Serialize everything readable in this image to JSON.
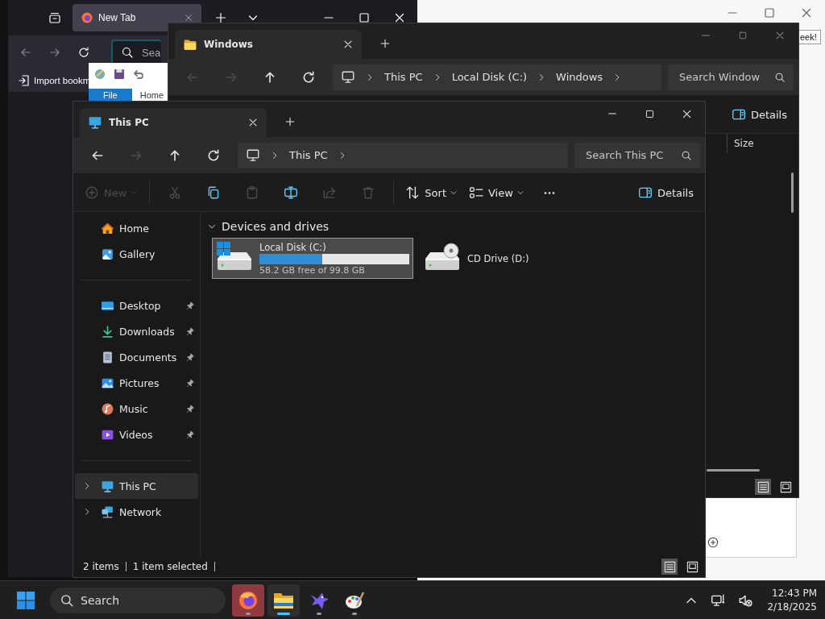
{
  "browser_window": {
    "tab": {
      "title": "New Tab"
    },
    "search": {
      "placeholder": "Sea"
    },
    "bookmarks": [
      {
        "label": "Import bookm"
      }
    ]
  },
  "ribbon_window": {
    "tabs": [
      {
        "label": "File",
        "selected": true
      },
      {
        "label": "Home",
        "selected": false
      }
    ]
  },
  "background_window": {
    "button": "eek!"
  },
  "folder_window": {
    "tab": "Windows",
    "nav": [
      {
        "kind": "back",
        "disabled": true
      },
      {
        "kind": "forward",
        "disabled": true
      },
      {
        "kind": "up",
        "disabled": false
      },
      {
        "kind": "refresh",
        "disabled": false
      }
    ],
    "breadcrumb": [
      "This PC",
      "Local Disk (C:)",
      "Windows"
    ],
    "search": {
      "placeholder": "Search Window"
    },
    "details_button": "Details",
    "columns": [
      "Size"
    ],
    "view_modes": [
      {
        "kind": "details",
        "selected": true
      },
      {
        "kind": "tiles",
        "selected": false
      }
    ]
  },
  "explorer": {
    "tab": "This PC",
    "nav": [
      {
        "kind": "back",
        "disabled": false
      },
      {
        "kind": "forward",
        "disabled": true
      },
      {
        "kind": "up",
        "disabled": false
      },
      {
        "kind": "refresh",
        "disabled": false
      }
    ],
    "breadcrumb": [
      "This PC"
    ],
    "search": {
      "placeholder": "Search This PC"
    },
    "toolbar": [
      {
        "kind": "new",
        "label": "New",
        "disabled": true
      },
      {
        "kind": "cut",
        "disabled": true
      },
      {
        "kind": "copy",
        "disabled": false
      },
      {
        "kind": "paste",
        "disabled": true
      },
      {
        "kind": "rename",
        "disabled": false
      },
      {
        "kind": "share",
        "disabled": true
      },
      {
        "kind": "delete",
        "disabled": true
      },
      {
        "kind": "sort",
        "label": "Sort",
        "disabled": false
      },
      {
        "kind": "view",
        "label": "View",
        "disabled": false
      },
      {
        "kind": "more",
        "disabled": false
      }
    ],
    "details_button": "Details",
    "sidebar": {
      "quick": [
        {
          "kind": "home",
          "label": "Home",
          "selected": false
        },
        {
          "kind": "gallery",
          "label": "Gallery",
          "selected": false
        }
      ],
      "pinned": [
        {
          "kind": "desktop",
          "label": "Desktop",
          "pinned": true,
          "selected": false
        },
        {
          "kind": "downloads",
          "label": "Downloads",
          "pinned": true,
          "selected": false
        },
        {
          "kind": "documents",
          "label": "Documents",
          "pinned": true,
          "selected": false
        },
        {
          "kind": "pictures",
          "label": "Pictures",
          "pinned": true,
          "selected": false
        },
        {
          "kind": "music",
          "label": "Music",
          "pinned": true,
          "selected": false
        },
        {
          "kind": "videos",
          "label": "Videos",
          "pinned": true,
          "selected": false
        }
      ],
      "tree": [
        {
          "kind": "pc",
          "label": "This PC",
          "expanded": false,
          "selected": true
        },
        {
          "kind": "network",
          "label": "Network",
          "expanded": false,
          "selected": false
        }
      ]
    },
    "section": {
      "title": "Devices and drives",
      "expanded": true
    },
    "drives": [
      {
        "kind": "system",
        "name": "Local Disk (C:)",
        "selected": true,
        "level": 0.42,
        "info": "58.2 GB free of 99.8 GB"
      },
      {
        "kind": "optical",
        "name": "CD Drive (D:)",
        "selected": false
      }
    ],
    "status": {
      "items": "2 items",
      "selection": "1 item selected"
    },
    "view_modes": [
      {
        "kind": "details",
        "selected": true
      },
      {
        "kind": "tiles",
        "selected": false
      }
    ]
  },
  "taskbar": {
    "search": {
      "placeholder": "Search"
    },
    "apps": [
      {
        "kind": "firefox",
        "selected": false,
        "flashing": true
      },
      {
        "kind": "files",
        "selected": true,
        "flashing": false
      },
      {
        "kind": "bird",
        "selected": false,
        "flashing": false
      },
      {
        "kind": "paint",
        "selected": false,
        "flashing": false
      }
    ],
    "clock": {
      "time": "12:43 PM",
      "date": "2/18/2025"
    }
  }
}
